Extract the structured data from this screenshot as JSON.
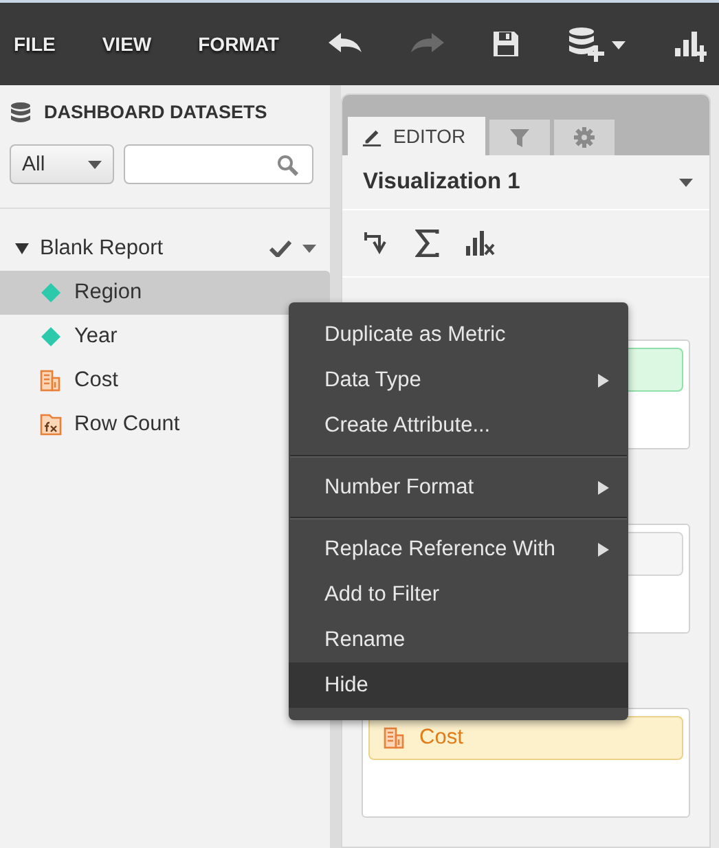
{
  "toolbar": {
    "menus": [
      "FILE",
      "VIEW",
      "FORMAT"
    ],
    "tools": [
      {
        "kind": "undo",
        "disabled": false
      },
      {
        "kind": "redo",
        "disabled": true
      },
      {
        "kind": "save",
        "disabled": false
      },
      {
        "kind": "add-data",
        "disabled": false
      },
      {
        "kind": "add-chart",
        "disabled": false
      }
    ]
  },
  "datasets_panel": {
    "title": "DASHBOARD DATASETS",
    "filter": {
      "value": "All"
    },
    "tree": [
      {
        "label": "Blank Report",
        "expanded": true,
        "selected": false,
        "children": [
          {
            "label": "Region",
            "kind": "attribute",
            "selected": true
          },
          {
            "label": "Year",
            "kind": "attribute",
            "selected": false
          },
          {
            "label": "Cost",
            "kind": "metric",
            "selected": false
          },
          {
            "label": "Row Count",
            "kind": "calculated",
            "selected": false
          }
        ]
      }
    ]
  },
  "editor_panel": {
    "tabs": [
      {
        "kind": "editor",
        "label": "EDITOR",
        "selected": true
      },
      {
        "kind": "filter",
        "selected": false
      },
      {
        "kind": "settings",
        "selected": false
      }
    ],
    "title": "Visualization 1",
    "drop_zones": [
      {
        "pills": [
          {
            "kind": "attribute"
          }
        ]
      },
      {
        "pills": [
          {
            "kind": "plain"
          }
        ]
      },
      {
        "pills": [
          {
            "kind": "metric",
            "label": "Cost"
          }
        ]
      }
    ]
  },
  "context_menu": {
    "groups": [
      [
        {
          "label": "Duplicate as Metric",
          "submenu": false,
          "selected": false
        },
        {
          "label": "Data Type",
          "submenu": true,
          "selected": false
        },
        {
          "label": "Create Attribute...",
          "submenu": false,
          "selected": false
        }
      ],
      [
        {
          "label": "Number Format",
          "submenu": true,
          "selected": false
        }
      ],
      [
        {
          "label": "Replace Reference With",
          "submenu": true,
          "selected": false
        },
        {
          "label": "Add to Filter",
          "submenu": false,
          "selected": false
        },
        {
          "label": "Rename",
          "submenu": false,
          "selected": false
        },
        {
          "label": "Hide",
          "submenu": false,
          "selected": true
        }
      ]
    ]
  }
}
